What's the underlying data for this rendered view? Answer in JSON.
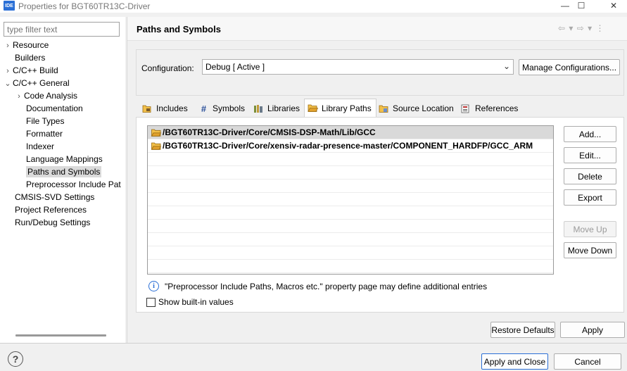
{
  "window": {
    "badge": "IDE",
    "title": "Properties for BGT60TR13C-Driver",
    "minimize": "—",
    "maximize": "☐",
    "close": "✕"
  },
  "filter": {
    "placeholder": "type filter text"
  },
  "tree": {
    "items": [
      {
        "label": "Resource",
        "chevron": "›"
      },
      {
        "label": "Builders",
        "chevron": ""
      },
      {
        "label": "C/C++ Build",
        "chevron": "›"
      },
      {
        "label": "C/C++ General",
        "chevron": "⌄"
      },
      {
        "label": "Code Analysis",
        "chevron": "›"
      },
      {
        "label": "Documentation",
        "chevron": ""
      },
      {
        "label": "File Types",
        "chevron": ""
      },
      {
        "label": "Formatter",
        "chevron": ""
      },
      {
        "label": "Indexer",
        "chevron": ""
      },
      {
        "label": "Language Mappings",
        "chevron": ""
      },
      {
        "label": "Paths and Symbols",
        "chevron": "",
        "selected": true
      },
      {
        "label": "Preprocessor Include Pat",
        "chevron": ""
      },
      {
        "label": "CMSIS-SVD Settings",
        "chevron": ""
      },
      {
        "label": "Project References",
        "chevron": ""
      },
      {
        "label": "Run/Debug Settings",
        "chevron": ""
      }
    ]
  },
  "page": {
    "title": "Paths and Symbols",
    "nav_icons": "⇦ ▾ ⇨ ▾ ⋮"
  },
  "configuration": {
    "label": "Configuration:",
    "value": "Debug  [ Active ]",
    "arrow": "⌄",
    "manage_button": "Manage Configurations..."
  },
  "tabs": [
    {
      "label": "Includes",
      "icon": "includes-icon",
      "glyph": "📂"
    },
    {
      "label": "Symbols",
      "icon": "hash-icon",
      "glyph": "#"
    },
    {
      "label": "Libraries",
      "icon": "libraries-icon",
      "glyph": "▤"
    },
    {
      "label": "Library Paths",
      "icon": "folder-icon",
      "glyph": "📂",
      "active": true
    },
    {
      "label": "Source Location",
      "icon": "source-folder-icon",
      "glyph": "📂"
    },
    {
      "label": "References",
      "icon": "references-icon",
      "glyph": "▤"
    }
  ],
  "library_paths": [
    "/BGT60TR13C-Driver/Core/CMSIS-DSP-Math/Lib/GCC",
    "/BGT60TR13C-Driver/Core/xensiv-radar-presence-master/COMPONENT_HARDFP/GCC_ARM"
  ],
  "side_buttons": {
    "add": "Add...",
    "edit": "Edit...",
    "delete": "Delete",
    "export": "Export",
    "move_up": "Move Up",
    "move_down": "Move Down"
  },
  "info_text": "\"Preprocessor Include Paths, Macros etc.\" property page may define additional entries",
  "show_builtin": {
    "label": "Show built-in values",
    "checked": false
  },
  "bottom": {
    "restore_defaults": "Restore Defaults",
    "apply": "Apply",
    "apply_and_close": "Apply and Close",
    "cancel": "Cancel",
    "help": "?"
  },
  "colors": {
    "accent": "#2a6fd6",
    "selection": "#d9d9d9",
    "folder": "#e1a12d"
  }
}
